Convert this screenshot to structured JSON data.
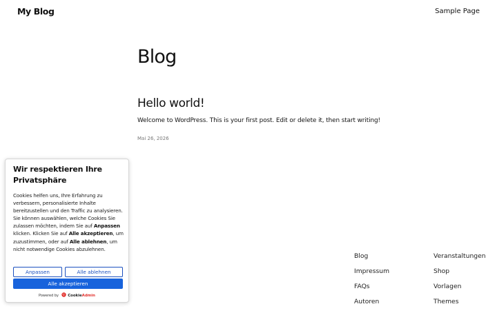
{
  "site": {
    "title": "My Blog"
  },
  "nav": {
    "items": [
      "Sample Page"
    ]
  },
  "main": {
    "heading": "Blog",
    "post": {
      "title": "Hello world!",
      "excerpt": "Welcome to WordPress. This is your first post. Edit or delete it, then start writing!",
      "date": "Mai 26, 2026"
    }
  },
  "footer": {
    "col1": [
      "Blog",
      "Impressum",
      "FAQs",
      "Autoren"
    ],
    "col2": [
      "Veranstaltungen",
      "Shop",
      "Vorlagen",
      "Themes"
    ]
  },
  "cookie_banner": {
    "title": "Wir respektieren Ihre Privatsphäre",
    "body_part1": "Cookies helfen uns, Ihre Erfahrung zu verbessern, personalisierte Inhalte bereitzustellen und den Traffic zu analysieren. Sie können auswählen, welche Cookies Sie zulassen möchten, indem Sie auf ",
    "body_bold1": "Anpassen",
    "body_part2": " klicken. Klicken Sie auf ",
    "body_bold2": "Alle akzeptieren",
    "body_part3": ", um zuzustimmen, oder auf ",
    "body_bold3": "Alle ablehnen",
    "body_part4": ", um nicht notwendige Cookies abzulehnen.",
    "customize_label": "Anpassen",
    "reject_label": "Alle ablehnen",
    "accept_label": "Alle akzeptieren",
    "powered_by": "Powered by",
    "brand_part1": "Cookie",
    "brand_part2": "Admin",
    "brand_icon": "cookieadmin-logo-icon",
    "accent_color": "#1863dc",
    "brand_color": "#e2312d"
  }
}
